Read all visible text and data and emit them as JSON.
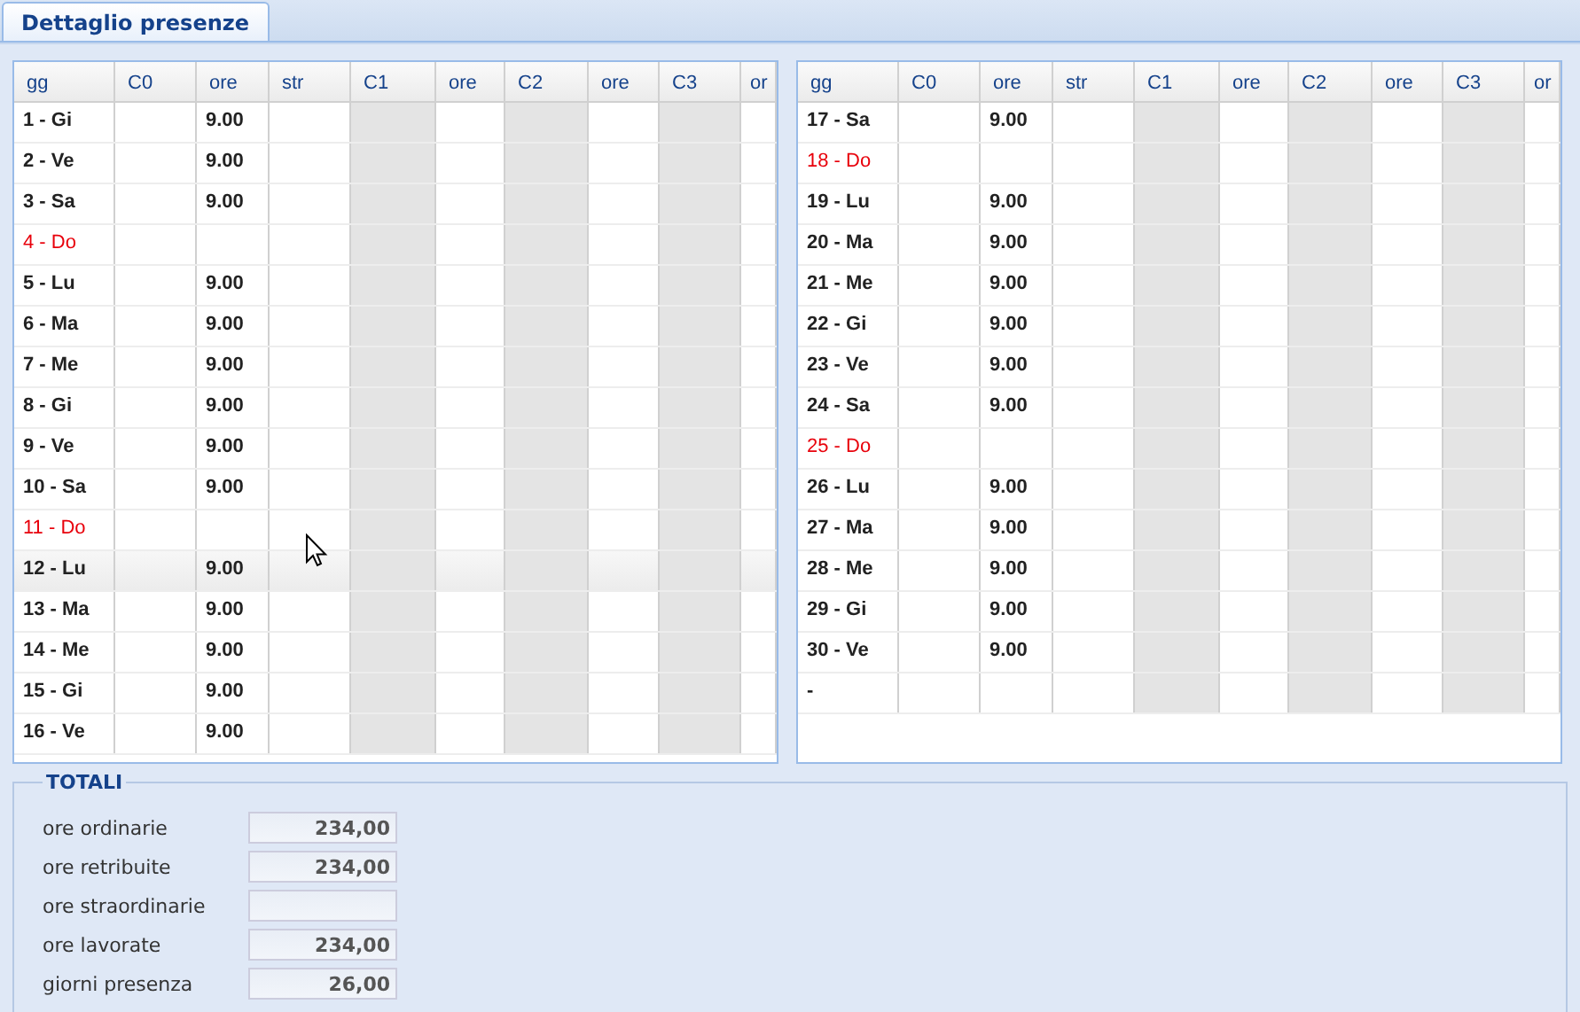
{
  "tabs": [
    {
      "label": "Dettaglio presenze",
      "selected": true
    }
  ],
  "grids": [
    {
      "columns": [
        {
          "label": "gg",
          "shaded": false
        },
        {
          "label": "C0",
          "shaded": false
        },
        {
          "label": "ore",
          "shaded": false
        },
        {
          "label": "str",
          "shaded": false
        },
        {
          "label": "C1",
          "shaded": true
        },
        {
          "label": "ore",
          "shaded": false
        },
        {
          "label": "C2",
          "shaded": true
        },
        {
          "label": "ore",
          "shaded": false
        },
        {
          "label": "C3",
          "shaded": true
        },
        {
          "label": "or",
          "shaded": false
        }
      ],
      "rows": [
        {
          "day": "1 - Gi",
          "holiday": false,
          "ore": "9.00",
          "selected": false
        },
        {
          "day": "2 - Ve",
          "holiday": false,
          "ore": "9.00",
          "selected": false
        },
        {
          "day": "3 - Sa",
          "holiday": false,
          "ore": "9.00",
          "selected": false
        },
        {
          "day": "4 - Do",
          "holiday": true,
          "selected": false
        },
        {
          "day": "5 - Lu",
          "holiday": false,
          "ore": "9.00",
          "selected": false
        },
        {
          "day": "6 - Ma",
          "holiday": false,
          "ore": "9.00",
          "selected": false
        },
        {
          "day": "7 - Me",
          "holiday": false,
          "ore": "9.00",
          "selected": false
        },
        {
          "day": "8 - Gi",
          "holiday": false,
          "ore": "9.00",
          "selected": false
        },
        {
          "day": "9 - Ve",
          "holiday": false,
          "ore": "9.00",
          "selected": false
        },
        {
          "day": "10 - Sa",
          "holiday": false,
          "ore": "9.00",
          "selected": false
        },
        {
          "day": "11 - Do",
          "holiday": true,
          "selected": false
        },
        {
          "day": "12 - Lu",
          "holiday": false,
          "ore": "9.00",
          "selected": true
        },
        {
          "day": "13 - Ma",
          "holiday": false,
          "ore": "9.00",
          "selected": false
        },
        {
          "day": "14 - Me",
          "holiday": false,
          "ore": "9.00",
          "selected": false
        },
        {
          "day": "15 - Gi",
          "holiday": false,
          "ore": "9.00",
          "selected": false
        },
        {
          "day": "16 - Ve",
          "holiday": false,
          "ore": "9.00",
          "selected": false
        }
      ]
    },
    {
      "columns": [
        {
          "label": "gg",
          "shaded": false
        },
        {
          "label": "C0",
          "shaded": false
        },
        {
          "label": "ore",
          "shaded": false
        },
        {
          "label": "str",
          "shaded": false
        },
        {
          "label": "C1",
          "shaded": true
        },
        {
          "label": "ore",
          "shaded": false
        },
        {
          "label": "C2",
          "shaded": true
        },
        {
          "label": "ore",
          "shaded": false
        },
        {
          "label": "C3",
          "shaded": true
        },
        {
          "label": "or",
          "shaded": false
        }
      ],
      "rows": [
        {
          "day": "17 - Sa",
          "holiday": false,
          "ore": "9.00",
          "selected": false
        },
        {
          "day": "18 - Do",
          "holiday": true,
          "selected": false
        },
        {
          "day": "19 - Lu",
          "holiday": false,
          "ore": "9.00",
          "selected": false
        },
        {
          "day": "20 - Ma",
          "holiday": false,
          "ore": "9.00",
          "selected": false
        },
        {
          "day": "21 - Me",
          "holiday": false,
          "ore": "9.00",
          "selected": false
        },
        {
          "day": "22 - Gi",
          "holiday": false,
          "ore": "9.00",
          "selected": false
        },
        {
          "day": "23 - Ve",
          "holiday": false,
          "ore": "9.00",
          "selected": false
        },
        {
          "day": "24 - Sa",
          "holiday": false,
          "ore": "9.00",
          "selected": false
        },
        {
          "day": "25 - Do",
          "holiday": true,
          "selected": false
        },
        {
          "day": "26 - Lu",
          "holiday": false,
          "ore": "9.00",
          "selected": false
        },
        {
          "day": "27 - Ma",
          "holiday": false,
          "ore": "9.00",
          "selected": false
        },
        {
          "day": "28 - Me",
          "holiday": false,
          "ore": "9.00",
          "selected": false
        },
        {
          "day": "29 - Gi",
          "holiday": false,
          "ore": "9.00",
          "selected": false
        },
        {
          "day": "30 - Ve",
          "holiday": false,
          "ore": "9.00",
          "selected": false
        },
        {
          "day": "-",
          "holiday": false,
          "selected": false
        }
      ]
    }
  ],
  "totals": {
    "title": "TOTALI",
    "fields": [
      {
        "label": "ore ordinarie",
        "value": "234,00"
      },
      {
        "label": "ore retribuite",
        "value": "234,00"
      },
      {
        "label": "ore straordinarie"
      },
      {
        "label": "ore lavorate",
        "value": "234,00"
      },
      {
        "label": "giorni presenza",
        "value": "26,00"
      }
    ]
  }
}
